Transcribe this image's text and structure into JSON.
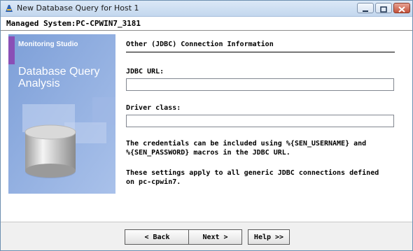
{
  "window": {
    "title": "New Database Query for Host 1",
    "icon": "app-icon"
  },
  "header": {
    "managed_system": "Managed System:PC-CPWIN7_3181"
  },
  "sidebar_image": {
    "brand": "Monitoring Studio",
    "title_line1": "Database Query",
    "title_line2": "Analysis",
    "accent_color": "#8a4fb6",
    "bg_color": "#8aa9dd"
  },
  "main": {
    "section_title": "Other (JDBC) Connection Information",
    "jdbc_url_label": "JDBC URL:",
    "jdbc_url_value": "",
    "driver_class_label": "Driver class:",
    "driver_class_value": "",
    "credentials_line1": "The credentials can be included using %{SEN_USERNAME} and",
    "credentials_line2": "%{SEN_PASSWORD} macros in the JDBC URL.",
    "settings_line1": "These settings apply to all generic JDBC connections defined",
    "settings_line2": "on pc-cpwin7."
  },
  "buttons": {
    "back": "< Back",
    "next": "Next >",
    "help": "Help >>"
  }
}
